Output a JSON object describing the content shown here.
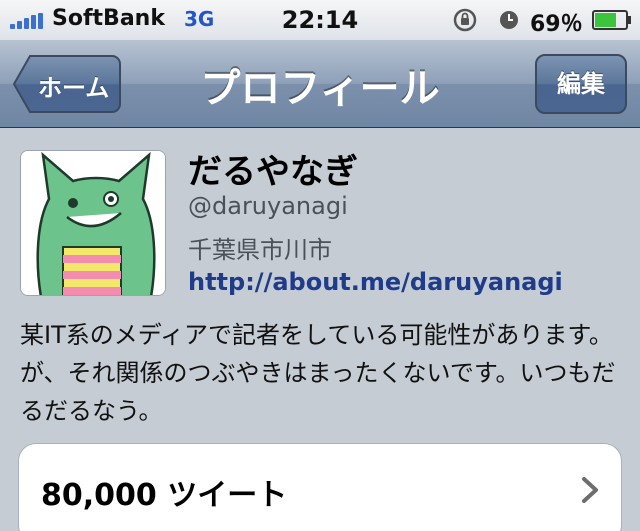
{
  "status_bar": {
    "carrier": "SoftBank",
    "network": "3G",
    "time": "22:14",
    "battery": "69％"
  },
  "nav": {
    "back_label": "ホーム",
    "title": "プロフィール",
    "edit_label": "編集"
  },
  "profile": {
    "name": "だるやなぎ",
    "handle": "@daruyanagi",
    "location": "千葉県市川市",
    "url": "http://about.me/daruyanagi",
    "bio": "某IT系のメディアで記者をしている可能性があります。が、それ関係のつぶやきはまったくないです。いつもだるだるなう。"
  },
  "stats": {
    "tweets_label": "80,000 ツイート"
  },
  "colors": {
    "nav_gradient_top": "#b7c3d2",
    "nav_gradient_bottom": "#6f86a4",
    "link": "#1f3c8a",
    "battery_green": "#3cc43c",
    "avatar_green": "#6cc48c"
  }
}
